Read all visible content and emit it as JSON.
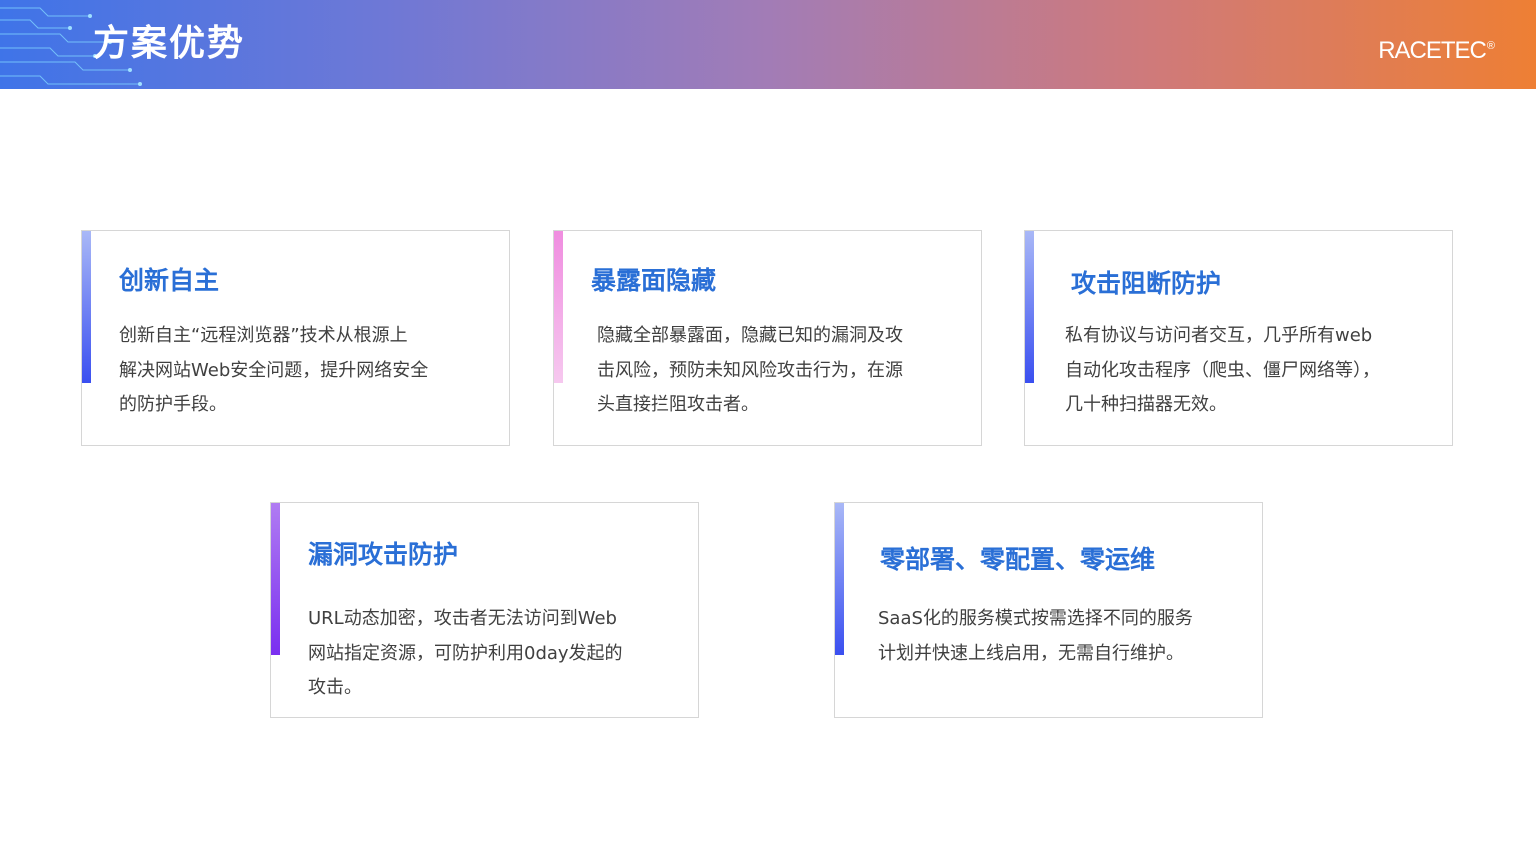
{
  "header": {
    "title": "方案优势",
    "logo_text": "RACETEC",
    "logo_mark": "®"
  },
  "colors": {
    "header_gradient_start": "#3f74e8",
    "header_gradient_end": "#ee7f34",
    "card_title": "#2a6fd6",
    "body_text": "#404040",
    "card_border": "#d6d6d6"
  },
  "cards": [
    {
      "title": "创新自主",
      "lines": [
        "创新自主“远程浏览器”技术从根源上",
        "解决网站Web安全问题，提升网络安全",
        "的防护手段。"
      ],
      "accent": "blue"
    },
    {
      "title": "暴露面隐藏",
      "lines": [
        "隐藏全部暴露面，隐藏已知的漏洞及攻",
        "击风险，预防未知风险攻击行为，在源",
        "头直接拦阻攻击者。"
      ],
      "accent": "pink"
    },
    {
      "title": "攻击阻断防护",
      "lines": [
        "私有协议与访问者交互，几乎所有web",
        "自动化攻击程序（爬虫、僵尸网络等），",
        "几十种扫描器无效。"
      ],
      "accent": "blue"
    },
    {
      "title": "漏洞攻击防护",
      "lines": [
        "URL动态加密，攻击者无法访问到Web",
        "网站指定资源，可防护利用0day发起的",
        "攻击。"
      ],
      "accent": "violet"
    },
    {
      "title": "零部署、零配置、零运维",
      "lines": [
        "SaaS化的服务模式按需选择不同的服务",
        "计划并快速上线启用，无需自行维护。"
      ],
      "accent": "blue"
    }
  ]
}
